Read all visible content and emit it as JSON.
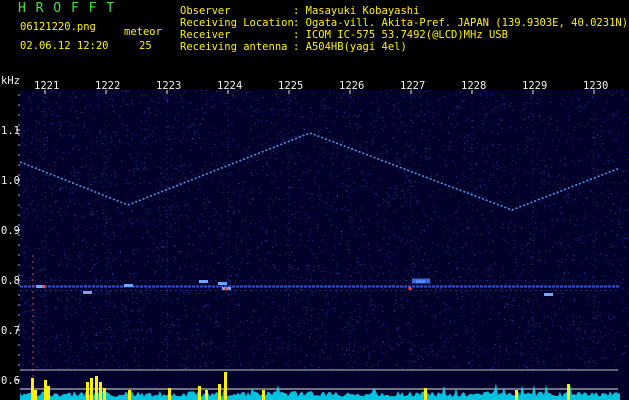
{
  "header": {
    "app_title": "H R O F F T",
    "filename": "06121220.png",
    "timestamp": "02.06.12 12:20",
    "meteor_label": "meteor",
    "meteor_count": "25"
  },
  "info": [
    {
      "label": "Observer",
      "value": ": Masayuki Kobayashi"
    },
    {
      "label": "Receiving Location",
      "value": ": Ogata-vill. Akita-Pref. JAPAN (139.9303E, 40.0231N)"
    },
    {
      "label": "Receiver",
      "value": ": ICOM IC-575 53.7492(@LCD)MHz USB"
    },
    {
      "label": "Receiving antenna",
      "value": ": A504HB(yagi 4el)"
    }
  ],
  "spectrogram": {
    "y_unit": "kHz",
    "y_ticks": [
      "1.1",
      "1.0",
      "0.9",
      "0.8",
      "0.7",
      "0.6"
    ],
    "time_labels": [
      "1221",
      "1222",
      "1223",
      "1224",
      "1225",
      "1226",
      "1227",
      "1228",
      "1229",
      "1230"
    ],
    "colors": {
      "background": "#00002a",
      "trace": "#4aa8ff",
      "signal_hot": "#ff4040",
      "yellow": "#fff200",
      "cyan": "#00e5ff",
      "label_yellow": "#fff200",
      "label_white": "#f2f2f2",
      "label_green": "#3fe43f"
    }
  }
}
